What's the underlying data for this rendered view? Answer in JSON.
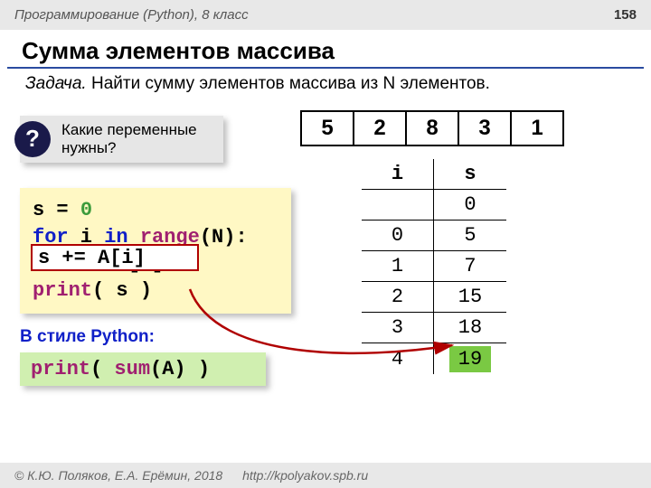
{
  "header": {
    "course": "Программирование (Python), 8 класс",
    "page": "158"
  },
  "title": "Сумма элементов массива",
  "task": {
    "label": "Задача.",
    "body": "Найти сумму элементов массива из N элементов."
  },
  "question": {
    "icon": "?",
    "text": "Какие переменные нужны?"
  },
  "array": [
    "5",
    "2",
    "8",
    "3",
    "1"
  ],
  "code1": {
    "l1a": "s = ",
    "l1b": "0",
    "l2a": "for",
    "l2b": " i ",
    "l2c": "in",
    "l2d": " ",
    "l2e": "range",
    "l2f": "(N):",
    "l3": "  s += A[i]",
    "l4a": "print",
    "l4b": "( s )"
  },
  "overlay": "s += A[i]",
  "pystyle": "В стиле Python:",
  "code2": {
    "a": "print",
    "b": "( ",
    "c": "sum",
    "d": "(A) )"
  },
  "trace": {
    "head": {
      "i": "i",
      "s": "s"
    },
    "rows": [
      {
        "i": "",
        "s": "0"
      },
      {
        "i": "0",
        "s": "5"
      },
      {
        "i": "1",
        "s": "7"
      },
      {
        "i": "2",
        "s": "15"
      },
      {
        "i": "3",
        "s": "18"
      },
      {
        "i": "4",
        "s": "19"
      }
    ]
  },
  "footer": {
    "copyright": "© К.Ю. Поляков, Е.А. Ерёмин, 2018",
    "url": "http://kpolyakov.spb.ru"
  }
}
